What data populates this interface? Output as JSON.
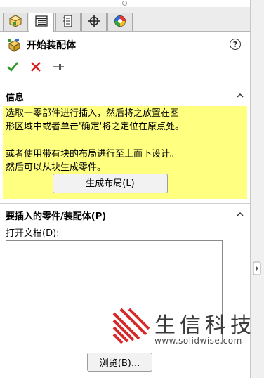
{
  "tabs": [
    {
      "name": "feature-manager",
      "icon": "feature-manager-icon"
    },
    {
      "name": "property-manager",
      "icon": "property-manager-icon",
      "active": true
    },
    {
      "name": "configuration-manager",
      "icon": "configuration-manager-icon"
    },
    {
      "name": "dimxpert-manager",
      "icon": "crosshair-icon"
    },
    {
      "name": "display-manager",
      "icon": "display-manager-icon"
    }
  ],
  "header": {
    "title": "开始装配体",
    "help": "?"
  },
  "actions": {
    "ok": "check-icon",
    "cancel": "close-icon",
    "pin": "pushpin-icon"
  },
  "info_section": {
    "title": "信息",
    "paragraph1": [
      "选取一零部件进行插入，然后将之放置在图",
      "形区域中或者单击'确定'将之定位在原点处。"
    ],
    "paragraph2": [
      "或者使用带有块的布局进行至上而下设计。",
      "然后可以从块生成零件。"
    ],
    "button_label": "生成布局(L)"
  },
  "insert_section": {
    "title": "要插入的零件/装配体(P)",
    "open_docs_label": "打开文档(D):",
    "browse_label": "浏览(B)..."
  },
  "watermark": {
    "brand": "生信科技",
    "url": "www.solidwise.com"
  },
  "colors": {
    "info_background": "#ffff80",
    "ok_green": "#2e9a2e",
    "cancel_red": "#d62020",
    "watermark_red": "#d42a2a"
  }
}
